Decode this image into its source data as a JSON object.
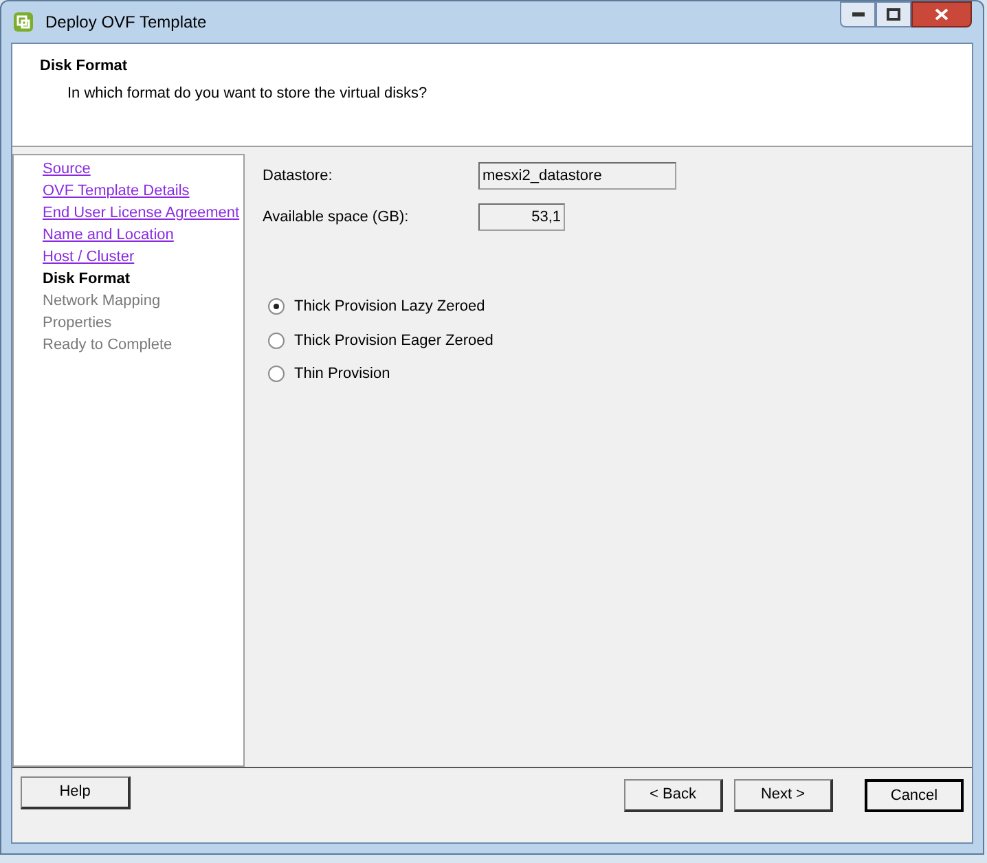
{
  "window": {
    "title": "Deploy OVF Template"
  },
  "header": {
    "title": "Disk Format",
    "subtitle": "In which format do you want to store the virtual disks?"
  },
  "steps": [
    {
      "label": "Source",
      "kind": "done"
    },
    {
      "label": "OVF Template Details",
      "kind": "done"
    },
    {
      "label": "End User License Agreement",
      "kind": "done"
    },
    {
      "label": "Name and Location",
      "kind": "done"
    },
    {
      "label": "Host / Cluster",
      "kind": "done"
    },
    {
      "label": "Disk Format",
      "kind": "current"
    },
    {
      "label": "Network Mapping",
      "kind": "pending"
    },
    {
      "label": "Properties",
      "kind": "pending"
    },
    {
      "label": "Ready to Complete",
      "kind": "pending"
    }
  ],
  "fields": [
    {
      "label": "Datastore:",
      "value": "mesxi2_datastore"
    },
    {
      "label": "Available space (GB):",
      "value": "53,1"
    }
  ],
  "formats": [
    {
      "label": "Thick Provision Lazy Zeroed",
      "selected": true
    },
    {
      "label": "Thick Provision Eager Zeroed",
      "selected": false
    },
    {
      "label": "Thin Provision",
      "selected": false
    }
  ],
  "buttons": {
    "help": "Help",
    "back": "< Back",
    "next": "Next >",
    "cancel": "Cancel"
  }
}
